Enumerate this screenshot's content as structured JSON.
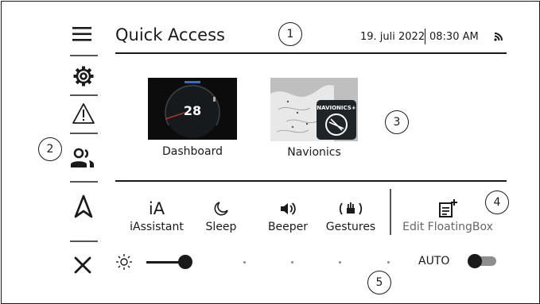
{
  "header": {
    "title": "Quick Access",
    "date": "19. juli 2022",
    "time": "08:30 AM",
    "wifi_icon": "wifi-icon"
  },
  "sidebar": [
    {
      "icon": "menu-icon"
    },
    {
      "icon": "settings-gear-icon"
    },
    {
      "icon": "warning-triangle-icon"
    },
    {
      "icon": "people-icon"
    },
    {
      "icon": "navigation-arrow-icon"
    },
    {
      "icon": "close-icon"
    }
  ],
  "tiles": [
    {
      "label": "Dashboard",
      "gauge_value": "28"
    },
    {
      "label": "Navionics",
      "badge_text": "NAVIONICS+"
    }
  ],
  "quick_buttons": [
    {
      "label": "iAssistant",
      "glyph": "iA"
    },
    {
      "label": "Sleep",
      "icon": "sleep-icon"
    },
    {
      "label": "Beeper",
      "icon": "speaker-icon"
    },
    {
      "label": "Gestures",
      "icon": "gestures-icon"
    }
  ],
  "edit_floatingbox": {
    "label": "Edit FloatingBox",
    "icon": "edit-note-plus-icon"
  },
  "brightness": {
    "icon": "sun-icon",
    "level": 0.16,
    "auto_label": "AUTO",
    "auto_on": true
  },
  "callouts": [
    "1",
    "2",
    "3",
    "4",
    "5"
  ],
  "colors": {
    "ink": "#1a1a1a",
    "muted": "#555555",
    "accent_red": "#c0392b"
  }
}
